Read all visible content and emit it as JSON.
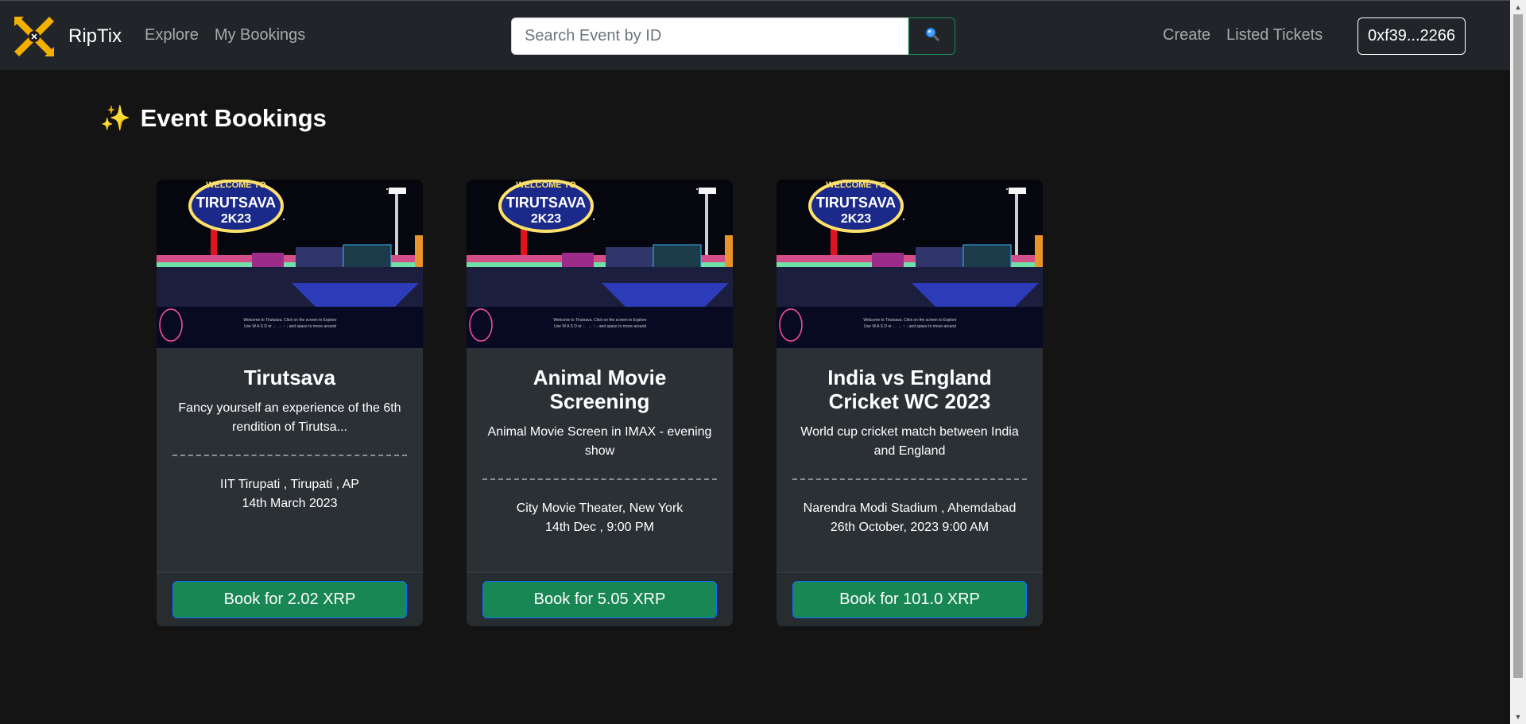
{
  "navbar": {
    "brand": "RipTix",
    "links_left": [
      "Explore",
      "My Bookings"
    ],
    "search_placeholder": "Search Event by ID",
    "search_icon": "magnifier-icon",
    "links_right": [
      "Create",
      "Listed Tickets"
    ],
    "wallet": "0xf39...2266"
  },
  "page": {
    "heading_icon": "✨",
    "heading": "Event Bookings"
  },
  "events": [
    {
      "title": "Tirutsava",
      "description": "Fancy yourself an experience of the 6th rendition of Tirutsa...",
      "location": "IIT Tirupati , Tirupati , AP",
      "date": "14th March 2023",
      "book_label": "Book for 2.02 XRP"
    },
    {
      "title": "Animal Movie Screening",
      "description": "Animal Movie Screen in IMAX - evening show",
      "location": "City Movie Theater, New York",
      "date": "14th Dec , 9:00 PM",
      "book_label": "Book for 5.05 XRP"
    },
    {
      "title": "India vs England Cricket WC 2023",
      "description": "World cup cricket match between India and England",
      "location": "Narendra Modi Stadium , Ahemdabad",
      "date": "26th October, 2023 9:00 AM",
      "book_label": "Book for 101.0 XRP"
    }
  ],
  "banner_image": {
    "sign_line1": "WELCOME TO",
    "sign_line2": "TIRUTSAVA",
    "sign_line3": "2K23",
    "caption_line1": "Welcome to Tirutsava. Click on the screen to Explore",
    "caption_line2": "Use W A S D or ← → ↑ ↓ and space to move around"
  }
}
